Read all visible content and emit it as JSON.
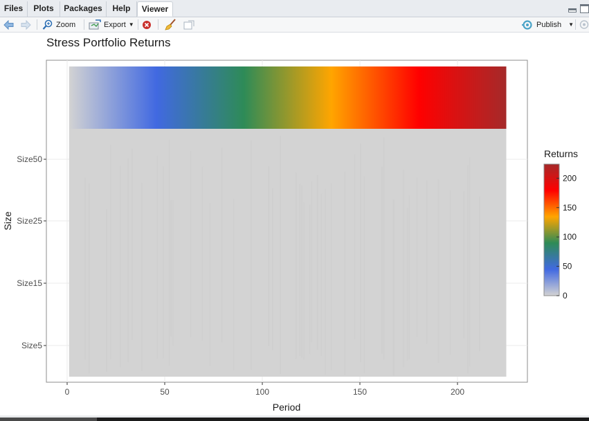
{
  "tabs": [
    {
      "label": "Files",
      "active": false
    },
    {
      "label": "Plots",
      "active": false
    },
    {
      "label": "Packages",
      "active": false
    },
    {
      "label": "Help",
      "active": false
    },
    {
      "label": "Viewer",
      "active": true
    }
  ],
  "toolbar": {
    "zoom_label": "Zoom",
    "export_label": "Export",
    "publish_label": "Publish",
    "icons": [
      "back-arrow-icon",
      "forward-arrow-icon",
      "zoom-icon",
      "export-icon",
      "remove-icon",
      "broom-icon",
      "popout-icon",
      "publish-icon",
      "refresh-icon"
    ]
  },
  "chart_data": {
    "type": "heatmap",
    "title": "Stress Portfolio Returns",
    "xlabel": "Period",
    "ylabel": "Size",
    "xlim": [
      -2,
      225
    ],
    "x_ticks": [
      0,
      50,
      100,
      150,
      200
    ],
    "y_categories": [
      "Size5",
      "Size15",
      "Size25",
      "Size50"
    ],
    "top_band": {
      "description_values_range": [
        0,
        224
      ],
      "period_range": [
        1,
        224
      ]
    },
    "background_value": 0,
    "legend": {
      "title": "Returns",
      "ticks": [
        0,
        50,
        100,
        150,
        200
      ],
      "range": [
        0,
        224
      ],
      "colors": [
        "#d3d3d3",
        "#4169e1",
        "#2e8b57",
        "#ffa500",
        "#ff0000",
        "#a52a2a"
      ],
      "placement": "right"
    },
    "grid": true
  }
}
